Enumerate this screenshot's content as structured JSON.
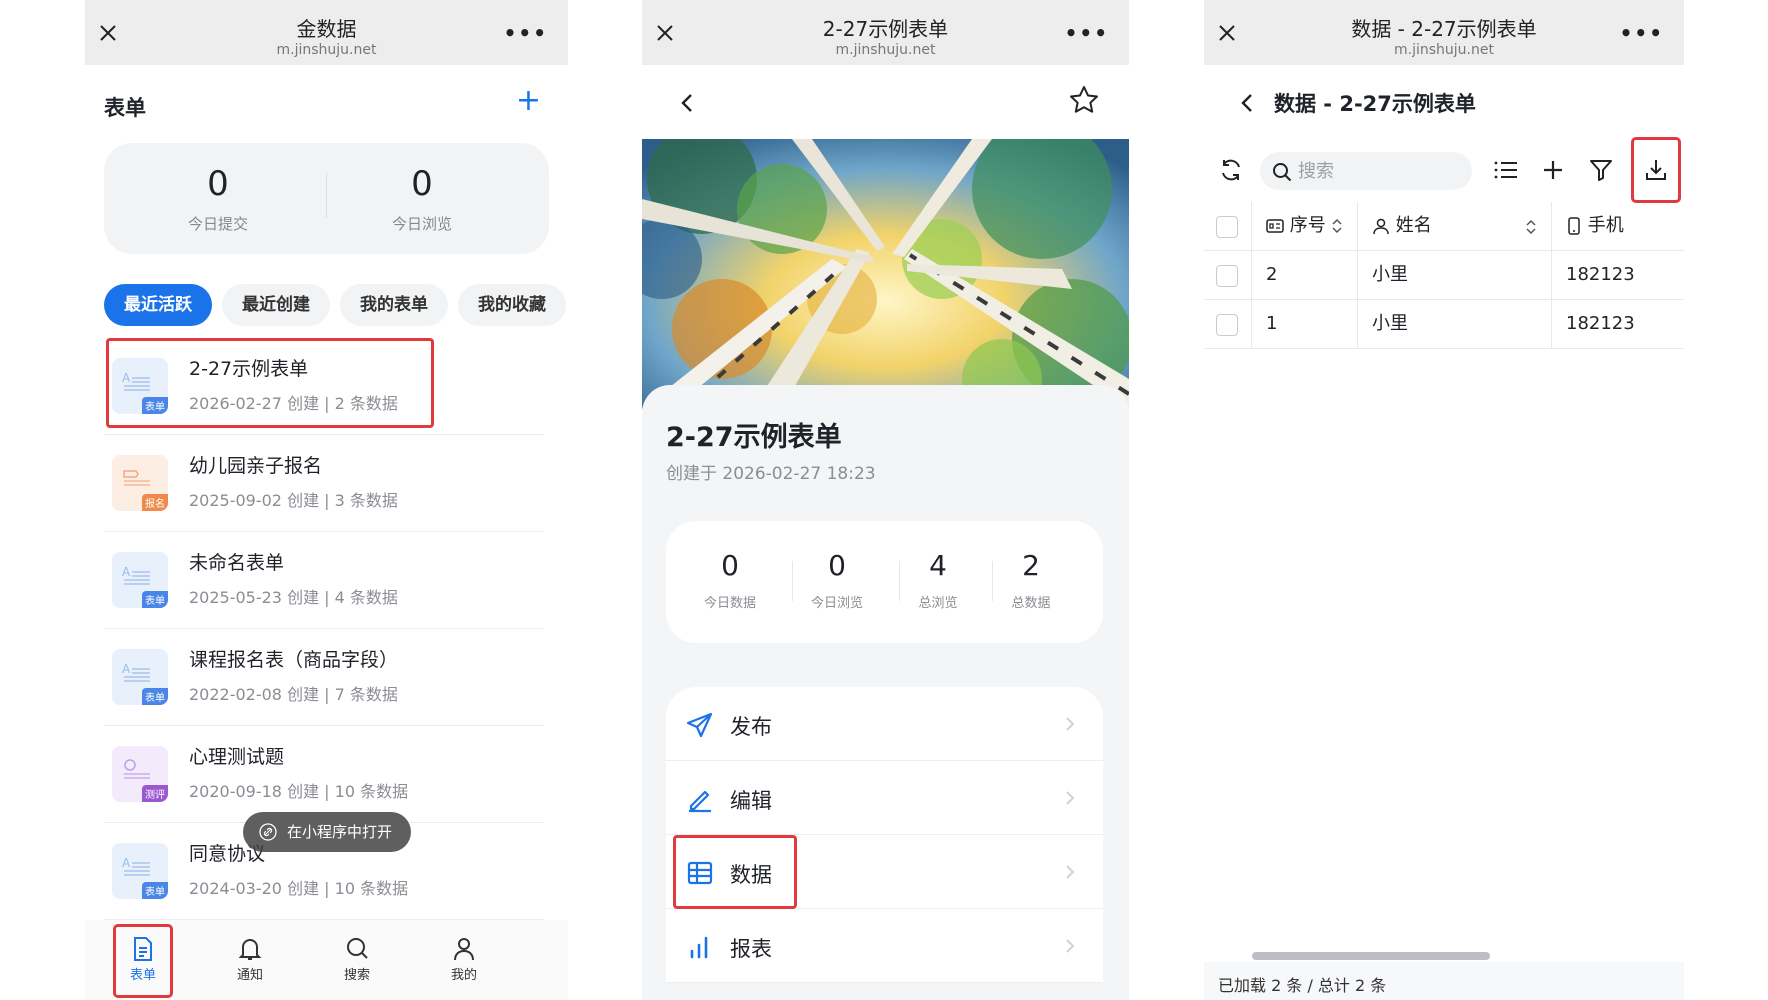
{
  "phone1": {
    "wx_title": "金数据",
    "wx_domain": "m.jinshuju.net",
    "header": "表单",
    "stats": [
      {
        "value": "0",
        "label": "今日提交"
      },
      {
        "value": "0",
        "label": "今日浏览"
      }
    ],
    "tabs": [
      "最近活跃",
      "最近创建",
      "我的表单",
      "我的收藏"
    ],
    "forms": [
      {
        "name": "2-27示例表单",
        "meta": "2026-02-27 创建  |  2 条数据",
        "tag": "表单",
        "color": "#4a86e8"
      },
      {
        "name": "幼儿园亲子报名",
        "meta": "2025-09-02 创建  |  3 条数据",
        "tag": "报名",
        "color": "#f08a4b"
      },
      {
        "name": "未命名表单",
        "meta": "2025-05-23 创建  |  4 条数据",
        "tag": "表单",
        "color": "#4a86e8"
      },
      {
        "name": "课程报名表（商品字段）",
        "meta": "2022-02-08 创建  |  7 条数据",
        "tag": "表单",
        "color": "#4a86e8"
      },
      {
        "name": "心理测试题",
        "meta": "2020-09-18 创建  |  10 条数据",
        "tag": "测评",
        "color": "#9b59d0"
      },
      {
        "name": "同意协议",
        "meta": "2024-03-20 创建  |  10 条数据",
        "tag": "表单",
        "color": "#4a86e8"
      }
    ],
    "float_pill": "在小程序中打开",
    "nav": [
      "表单",
      "通知",
      "搜索",
      "我的"
    ]
  },
  "phone2": {
    "wx_title": "2-27示例表单",
    "wx_domain": "m.jinshuju.net",
    "title": "2-27示例表单",
    "created": "创建于 2026-02-27 18:23",
    "stats": [
      {
        "value": "0",
        "label": "今日数据"
      },
      {
        "value": "0",
        "label": "今日浏览"
      },
      {
        "value": "4",
        "label": "总浏览"
      },
      {
        "value": "2",
        "label": "总数据"
      }
    ],
    "menu": [
      "发布",
      "编辑",
      "数据",
      "报表"
    ]
  },
  "phone3": {
    "wx_title": "数据 - 2-27示例表单",
    "wx_domain": "m.jinshuju.net",
    "title": "数据 - 2-27示例表单",
    "search_placeholder": "搜索",
    "columns": [
      "序号",
      "姓名",
      "手机"
    ],
    "rows": [
      {
        "seq": "2",
        "name": "小里",
        "phone": "182123"
      },
      {
        "seq": "1",
        "name": "小里",
        "phone": "182123"
      }
    ],
    "footer": "已加载 2 条 / 总计 2 条"
  },
  "colors": {
    "accent": "#1a73e8",
    "highlight": "#e0393e"
  }
}
